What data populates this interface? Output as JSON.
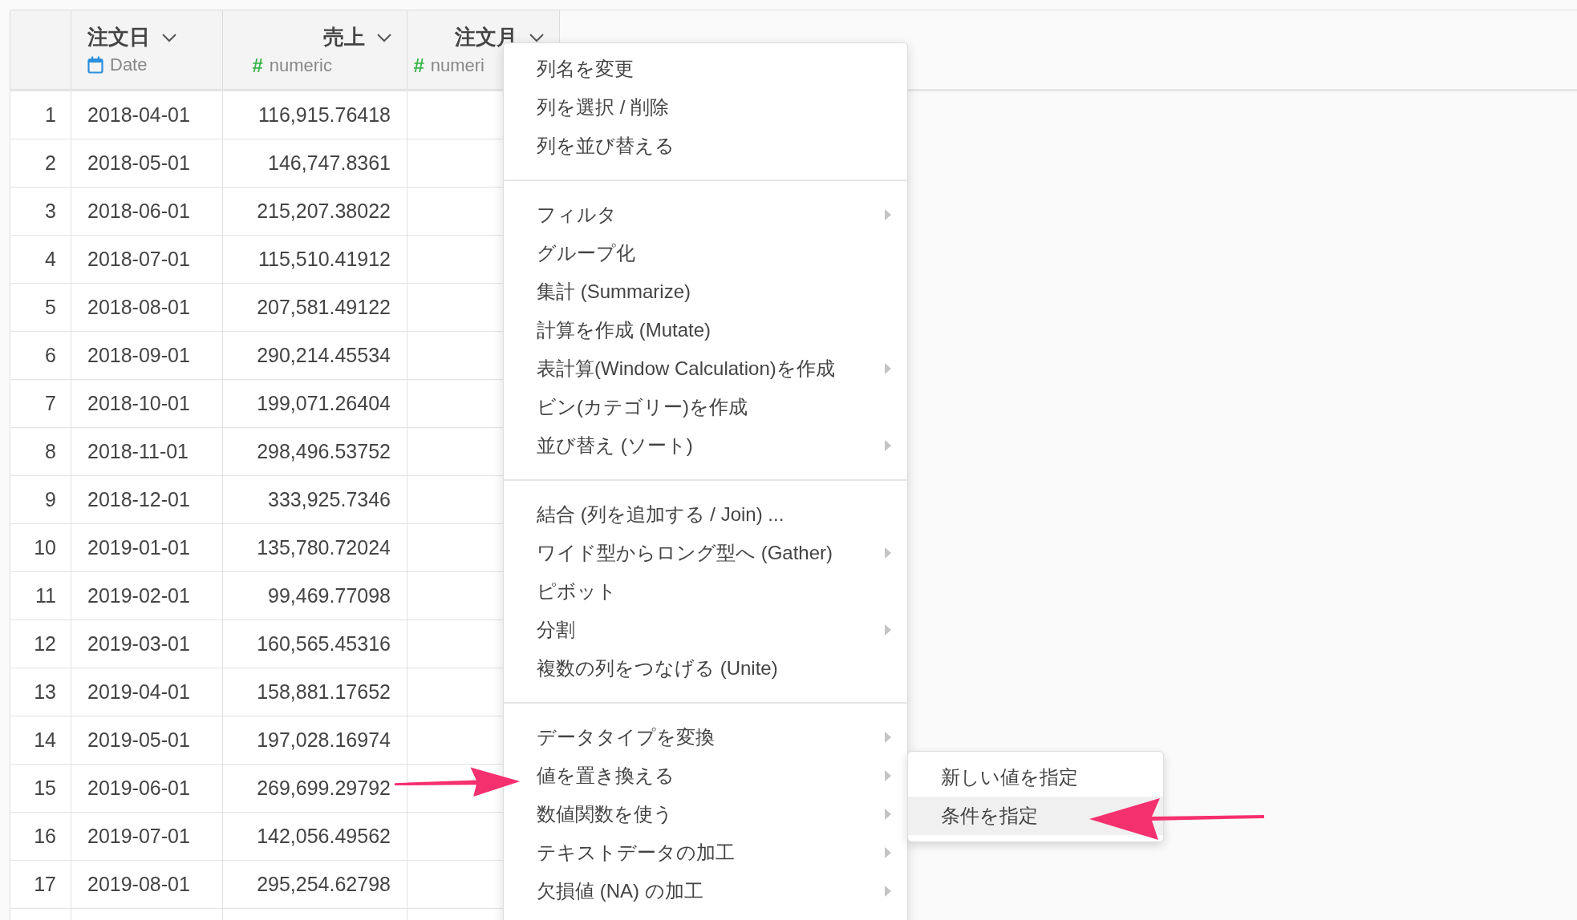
{
  "table": {
    "columns": [
      {
        "name": "注文日",
        "kind": "date",
        "type_label": "Date"
      },
      {
        "name": "売上",
        "kind": "numeric",
        "type_symbol": "#",
        "type_label": "numeric"
      },
      {
        "name": "注文月",
        "kind": "numeric",
        "type_symbol": "#",
        "type_label": "numeri"
      }
    ],
    "rows": [
      {
        "number": "1",
        "cells": [
          "2018-04-01",
          "116,915.76418"
        ]
      },
      {
        "number": "2",
        "cells": [
          "2018-05-01",
          "146,747.8361"
        ]
      },
      {
        "number": "3",
        "cells": [
          "2018-06-01",
          "215,207.38022"
        ]
      },
      {
        "number": "4",
        "cells": [
          "2018-07-01",
          "115,510.41912"
        ]
      },
      {
        "number": "5",
        "cells": [
          "2018-08-01",
          "207,581.49122"
        ]
      },
      {
        "number": "6",
        "cells": [
          "2018-09-01",
          "290,214.45534"
        ]
      },
      {
        "number": "7",
        "cells": [
          "2018-10-01",
          "199,071.26404"
        ]
      },
      {
        "number": "8",
        "cells": [
          "2018-11-01",
          "298,496.53752"
        ]
      },
      {
        "number": "9",
        "cells": [
          "2018-12-01",
          "333,925.7346"
        ]
      },
      {
        "number": "10",
        "cells": [
          "2019-01-01",
          "135,780.72024"
        ]
      },
      {
        "number": "11",
        "cells": [
          "2019-02-01",
          "99,469.77098"
        ]
      },
      {
        "number": "12",
        "cells": [
          "2019-03-01",
          "160,565.45316"
        ]
      },
      {
        "number": "13",
        "cells": [
          "2019-04-01",
          "158,881.17652"
        ]
      },
      {
        "number": "14",
        "cells": [
          "2019-05-01",
          "197,028.16974"
        ]
      },
      {
        "number": "15",
        "cells": [
          "2019-06-01",
          "269,699.29792"
        ]
      },
      {
        "number": "16",
        "cells": [
          "2019-07-01",
          "142,056.49562"
        ]
      },
      {
        "number": "17",
        "cells": [
          "2019-08-01",
          "295,254.62798"
        ]
      }
    ]
  },
  "context_menu": {
    "sections": [
      [
        {
          "label": "列名を変更",
          "submenu": false
        },
        {
          "label": "列を選択 / 削除",
          "submenu": false
        },
        {
          "label": "列を並び替える",
          "submenu": false
        }
      ],
      [
        {
          "label": "フィルタ",
          "submenu": true
        },
        {
          "label": "グループ化",
          "submenu": false
        },
        {
          "label": "集計 (Summarize)",
          "submenu": false
        },
        {
          "label": "計算を作成 (Mutate)",
          "submenu": false
        },
        {
          "label": "表計算(Window Calculation)を作成",
          "submenu": true
        },
        {
          "label": "ビン(カテゴリー)を作成",
          "submenu": false
        },
        {
          "label": "並び替え (ソート)",
          "submenu": true
        }
      ],
      [
        {
          "label": "結合 (列を追加する / Join) ...",
          "submenu": false
        },
        {
          "label": "ワイド型からロング型へ (Gather)",
          "submenu": true
        },
        {
          "label": "ピボット",
          "submenu": false
        },
        {
          "label": "分割",
          "submenu": true
        },
        {
          "label": "複数の列をつなげる (Unite)",
          "submenu": false
        }
      ],
      [
        {
          "label": "データタイプを変換",
          "submenu": true
        },
        {
          "label": "値を置き換える",
          "submenu": true
        },
        {
          "label": "数値関数を使う",
          "submenu": true
        },
        {
          "label": "テキストデータの加工",
          "submenu": true
        },
        {
          "label": "欠損値 (NA) の加工",
          "submenu": true
        }
      ]
    ]
  },
  "submenu": {
    "items": [
      {
        "label": "新しい値を指定",
        "selected": false
      },
      {
        "label": "条件を指定",
        "selected": true
      }
    ]
  }
}
